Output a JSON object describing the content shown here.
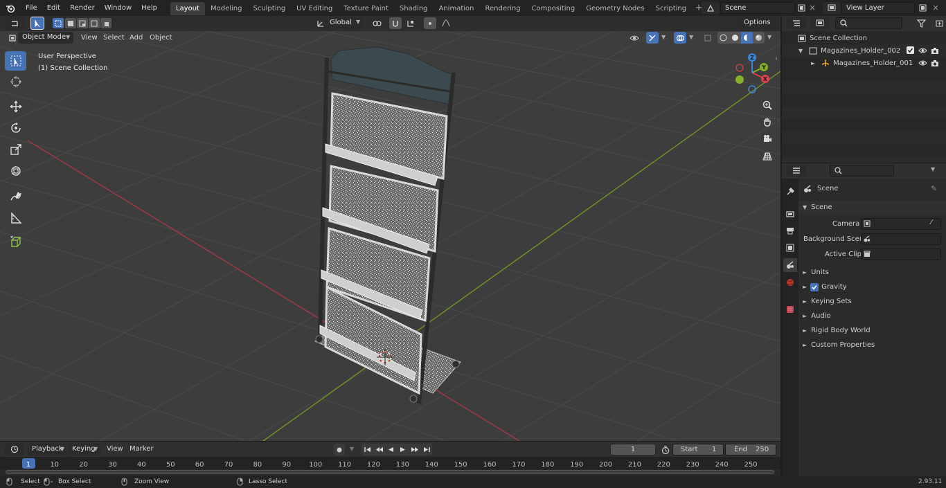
{
  "menus": [
    "File",
    "Edit",
    "Render",
    "Window",
    "Help"
  ],
  "workspaces": [
    "Layout",
    "Modeling",
    "Sculpting",
    "UV Editing",
    "Texture Paint",
    "Shading",
    "Animation",
    "Rendering",
    "Compositing",
    "Geometry Nodes",
    "Scripting"
  ],
  "active_workspace": "Layout",
  "scene_field": "Scene",
  "view_layer_field": "View Layer",
  "viewport_header": {
    "mode": "Object Mode",
    "view": "View",
    "select": "Select",
    "add": "Add",
    "object": "Object",
    "transform_orientation": "Global",
    "options": "Options"
  },
  "viewport_overlay": {
    "perspective": "User Perspective",
    "collection": "(1) Scene Collection"
  },
  "gizmo": {
    "x": "X",
    "y": "Y",
    "z": "Z"
  },
  "outliner": {
    "items": [
      {
        "label": "Scene Collection"
      },
      {
        "label": "Magazines_Holder_002"
      },
      {
        "label": "Magazines_Holder_001"
      }
    ]
  },
  "properties": {
    "header": "Scene",
    "section": "Scene",
    "camera_label": "Camera",
    "background_scene_label": "Background Scene",
    "active_clip_label": "Active Clip",
    "panels": [
      "Units",
      "Gravity",
      "Keying Sets",
      "Audio",
      "Rigid Body World",
      "Custom Properties"
    ]
  },
  "timeline": {
    "playback": "Playback",
    "keying": "Keying",
    "view": "View",
    "marker": "Marker",
    "current_frame": "1",
    "start_label": "Start",
    "start_value": "1",
    "end_label": "End",
    "end_value": "250",
    "ticks": [
      "1",
      "10",
      "20",
      "30",
      "40",
      "50",
      "60",
      "70",
      "80",
      "90",
      "100",
      "110",
      "120",
      "130",
      "140",
      "150",
      "160",
      "170",
      "180",
      "190",
      "200",
      "210",
      "220",
      "230",
      "240",
      "250"
    ]
  },
  "statusbar": {
    "select": "Select",
    "box_select": "Box Select",
    "zoom_view": "Zoom View",
    "lasso_select": "Lasso Select",
    "version": "2.93.11"
  },
  "colors": {
    "accent": "#4772b3",
    "x_axis": "#d9434f",
    "y_axis": "#86b02b",
    "z_axis": "#3d86d6"
  }
}
